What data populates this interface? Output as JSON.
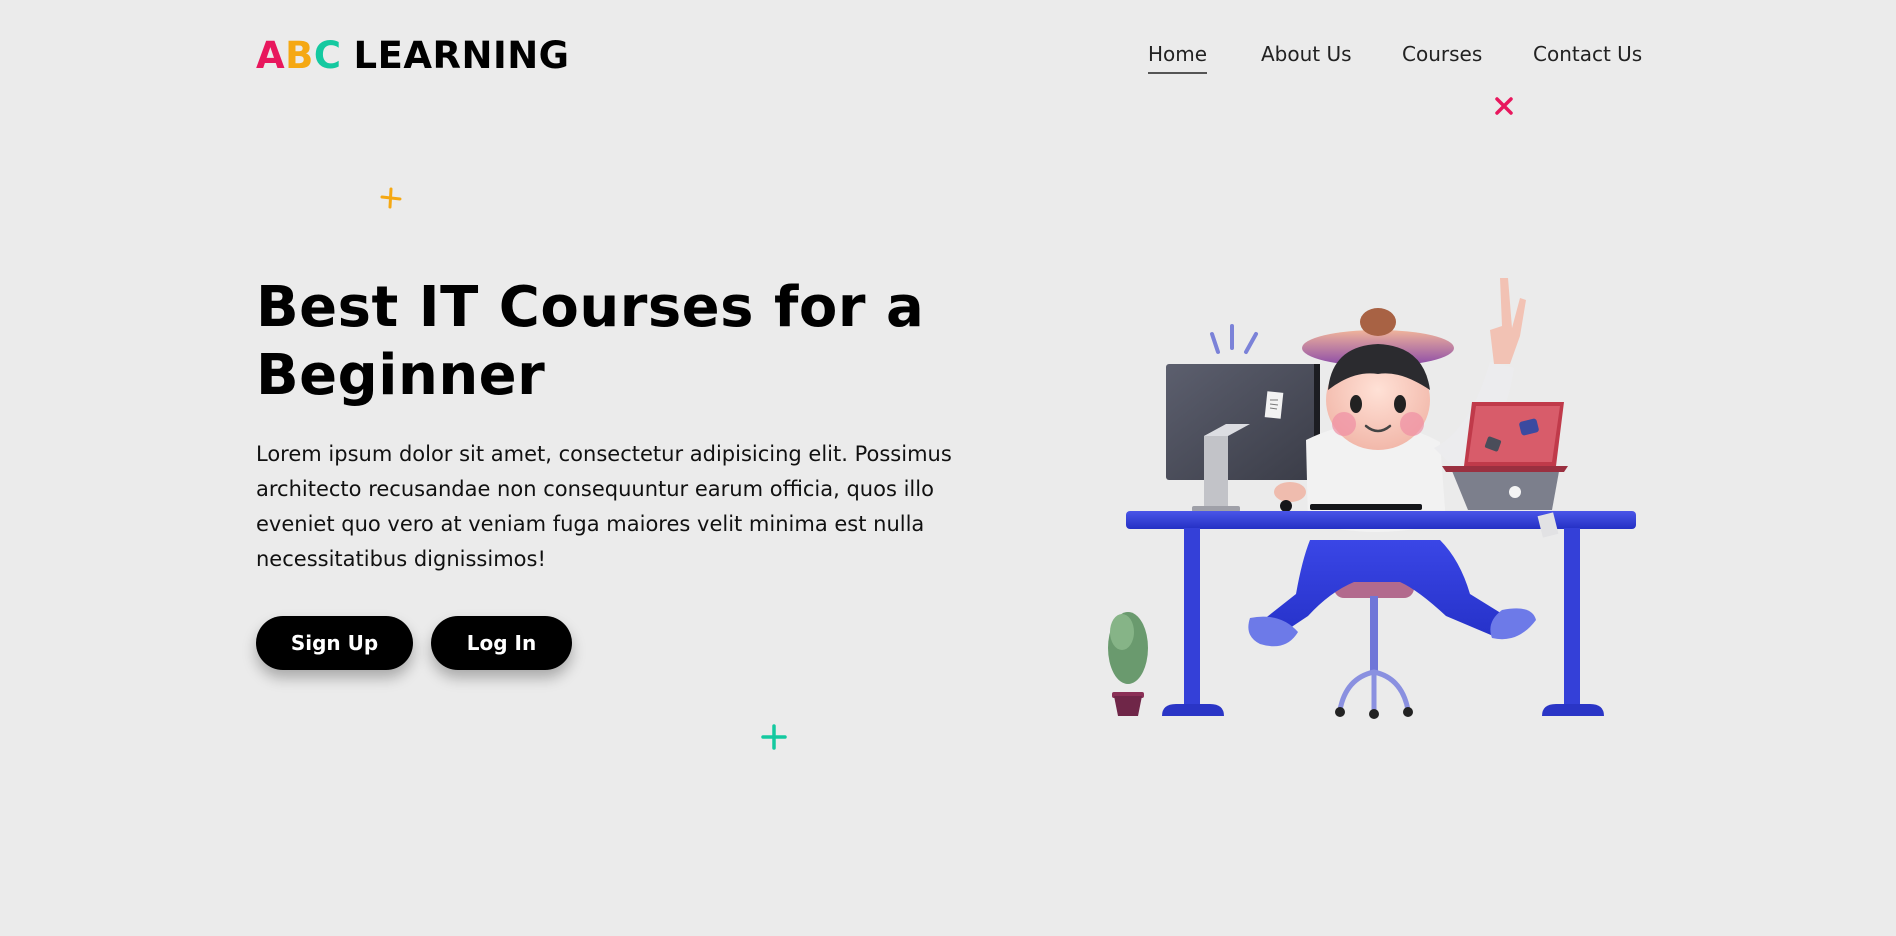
{
  "logo": {
    "letters": [
      "A",
      "B",
      "C"
    ],
    "word": "LEARNING"
  },
  "nav": {
    "items": [
      {
        "label": "Home",
        "active": true
      },
      {
        "label": "About Us",
        "active": false
      },
      {
        "label": "Courses",
        "active": false
      },
      {
        "label": "Contact Us",
        "active": false
      }
    ]
  },
  "hero": {
    "title_line1": "Best IT Courses for a",
    "title_line2": "Beginner",
    "text": "Lorem ipsum dolor sit amet, consectetur adipisicing elit. Possimus architecto recusandae non consequuntur earum officia, quos illo eveniet quo vero at veniam fuga maiores velit minima est nulla necessitatibus dignissimos!",
    "signup_label": "Sign Up",
    "login_label": "Log In"
  },
  "colors": {
    "background": "#ebebeb",
    "accent_pink": "#e8175d",
    "accent_yellow": "#f5a813",
    "accent_green": "#14c9a0",
    "desk_blue": "#2f3bd6"
  },
  "icons": {
    "decor": [
      "pink-x-icon",
      "yellow-plus-icon",
      "green-plus-icon"
    ],
    "illustration": "student-at-desk-illustration"
  }
}
